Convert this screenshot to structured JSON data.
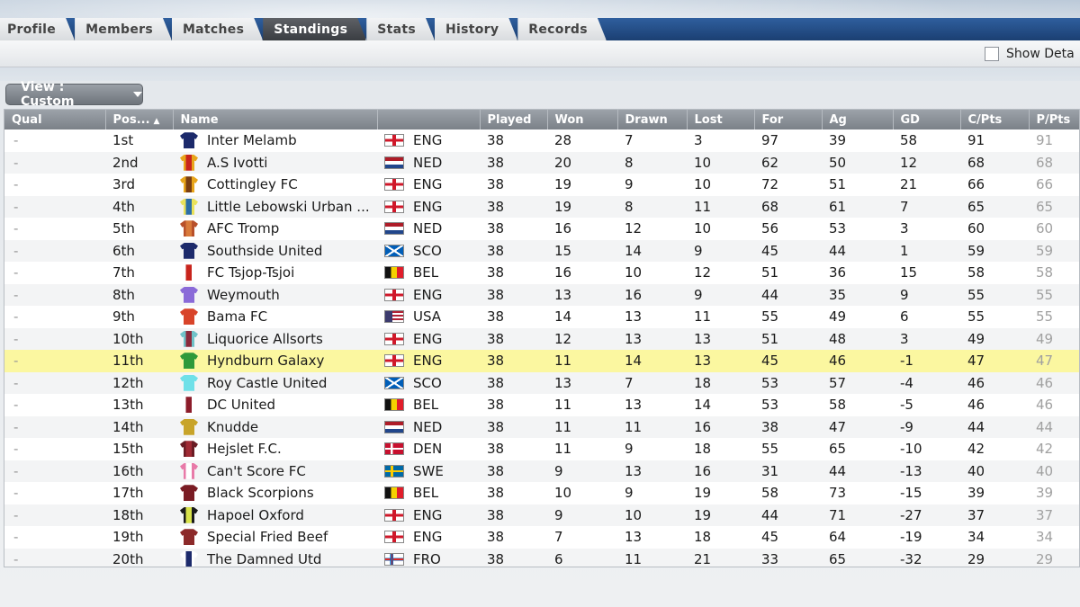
{
  "tabs": [
    {
      "label": "Profile",
      "active": false
    },
    {
      "label": "Members",
      "active": false
    },
    {
      "label": "Matches",
      "active": false
    },
    {
      "label": "Standings",
      "active": true
    },
    {
      "label": "Stats",
      "active": false
    },
    {
      "label": "History",
      "active": false
    },
    {
      "label": "Records",
      "active": false
    }
  ],
  "toolbar": {
    "show_detail_label": "Show Deta"
  },
  "view_button": {
    "label": "View : Custom"
  },
  "columns": [
    "Qual",
    "Pos...",
    "Name",
    "",
    "Played",
    "Won",
    "Drawn",
    "Lost",
    "For",
    "Ag",
    "GD",
    "C/Pts",
    "P/Pts"
  ],
  "sort_column": "Pos...",
  "rows": [
    {
      "qual": "-",
      "pos": "1st",
      "name": "Inter Melamb",
      "nation": "ENG",
      "played": "38",
      "won": "28",
      "drawn": "7",
      "lost": "3",
      "for": "97",
      "ag": "39",
      "gd": "58",
      "cpts": "91",
      "ppts": "91",
      "kit": [
        "#1c2a6b",
        "#1c2a6b"
      ],
      "flag": "eng"
    },
    {
      "qual": "-",
      "pos": "2nd",
      "name": "A.S Ivotti",
      "nation": "NED",
      "played": "38",
      "won": "20",
      "drawn": "8",
      "lost": "10",
      "for": "62",
      "ag": "50",
      "gd": "12",
      "cpts": "68",
      "ppts": "68",
      "kit": [
        "#e8a51a",
        "#c8241c"
      ],
      "flag": "ned"
    },
    {
      "qual": "-",
      "pos": "3rd",
      "name": "Cottingley FC",
      "nation": "ENG",
      "played": "38",
      "won": "19",
      "drawn": "9",
      "lost": "10",
      "for": "72",
      "ag": "51",
      "gd": "21",
      "cpts": "66",
      "ppts": "66",
      "kit": [
        "#e8a51a",
        "#7a3e12"
      ],
      "flag": "eng"
    },
    {
      "qual": "-",
      "pos": "4th",
      "name": "Little Lebowski Urban ...",
      "nation": "ENG",
      "played": "38",
      "won": "19",
      "drawn": "8",
      "lost": "11",
      "for": "68",
      "ag": "61",
      "gd": "7",
      "cpts": "65",
      "ppts": "65",
      "kit": [
        "#e9e25a",
        "#2b6ea8"
      ],
      "flag": "eng"
    },
    {
      "qual": "-",
      "pos": "5th",
      "name": "AFC Tromp",
      "nation": "NED",
      "played": "38",
      "won": "16",
      "drawn": "12",
      "lost": "10",
      "for": "56",
      "ag": "53",
      "gd": "3",
      "cpts": "60",
      "ppts": "60",
      "kit": [
        "#b8502a",
        "#d97a3a"
      ],
      "flag": "ned"
    },
    {
      "qual": "-",
      "pos": "6th",
      "name": "Southside United",
      "nation": "SCO",
      "played": "38",
      "won": "15",
      "drawn": "14",
      "lost": "9",
      "for": "45",
      "ag": "44",
      "gd": "1",
      "cpts": "59",
      "ppts": "59",
      "kit": [
        "#1c2a6b",
        "#1c2a6b"
      ],
      "flag": "sco"
    },
    {
      "qual": "-",
      "pos": "7th",
      "name": "FC Tsjop-Tsjoi",
      "nation": "BEL",
      "played": "38",
      "won": "16",
      "drawn": "10",
      "lost": "12",
      "for": "51",
      "ag": "36",
      "gd": "15",
      "cpts": "58",
      "ppts": "58",
      "kit": [
        "#ffffff",
        "#c8241c"
      ],
      "flag": "bel"
    },
    {
      "qual": "-",
      "pos": "8th",
      "name": "Weymouth",
      "nation": "ENG",
      "played": "38",
      "won": "13",
      "drawn": "16",
      "lost": "9",
      "for": "44",
      "ag": "35",
      "gd": "9",
      "cpts": "55",
      "ppts": "55",
      "kit": [
        "#8a6ad8",
        "#8a6ad8"
      ],
      "flag": "eng"
    },
    {
      "qual": "-",
      "pos": "9th",
      "name": "Bama FC",
      "nation": "USA",
      "played": "38",
      "won": "14",
      "drawn": "13",
      "lost": "11",
      "for": "55",
      "ag": "49",
      "gd": "6",
      "cpts": "55",
      "ppts": "55",
      "kit": [
        "#d8442a",
        "#d8442a"
      ],
      "flag": "usa"
    },
    {
      "qual": "-",
      "pos": "10th",
      "name": "Liquorice Allsorts",
      "nation": "ENG",
      "played": "38",
      "won": "12",
      "drawn": "13",
      "lost": "13",
      "for": "51",
      "ag": "48",
      "gd": "3",
      "cpts": "49",
      "ppts": "49",
      "kit": [
        "#6fc2c8",
        "#8c2a3c"
      ],
      "flag": "eng"
    },
    {
      "qual": "-",
      "pos": "11th",
      "name": "Hyndburn Galaxy",
      "nation": "ENG",
      "played": "38",
      "won": "11",
      "drawn": "14",
      "lost": "13",
      "for": "45",
      "ag": "46",
      "gd": "-1",
      "cpts": "47",
      "ppts": "47",
      "kit": [
        "#2e9a3a",
        "#2e9a3a"
      ],
      "flag": "eng",
      "highlight": true
    },
    {
      "qual": "-",
      "pos": "12th",
      "name": "Roy Castle United",
      "nation": "SCO",
      "played": "38",
      "won": "13",
      "drawn": "7",
      "lost": "18",
      "for": "53",
      "ag": "57",
      "gd": "-4",
      "cpts": "46",
      "ppts": "46",
      "kit": [
        "#6fe0e8",
        "#6fe0e8"
      ],
      "flag": "sco"
    },
    {
      "qual": "-",
      "pos": "13th",
      "name": "DC United",
      "nation": "BEL",
      "played": "38",
      "won": "11",
      "drawn": "13",
      "lost": "14",
      "for": "53",
      "ag": "58",
      "gd": "-5",
      "cpts": "46",
      "ppts": "46",
      "kit": [
        "#ffffff",
        "#8c1c2a"
      ],
      "flag": "bel"
    },
    {
      "qual": "-",
      "pos": "14th",
      "name": "Knudde",
      "nation": "NED",
      "played": "38",
      "won": "11",
      "drawn": "11",
      "lost": "16",
      "for": "38",
      "ag": "47",
      "gd": "-9",
      "cpts": "44",
      "ppts": "44",
      "kit": [
        "#c8a42a",
        "#c8a42a"
      ],
      "flag": "ned"
    },
    {
      "qual": "-",
      "pos": "15th",
      "name": "Hejslet F.C.",
      "nation": "DEN",
      "played": "38",
      "won": "11",
      "drawn": "9",
      "lost": "18",
      "for": "55",
      "ag": "65",
      "gd": "-10",
      "cpts": "42",
      "ppts": "42",
      "kit": [
        "#6a1c24",
        "#a02a34"
      ],
      "flag": "den"
    },
    {
      "qual": "-",
      "pos": "16th",
      "name": "Can't Score FC",
      "nation": "SWE",
      "played": "38",
      "won": "9",
      "drawn": "13",
      "lost": "16",
      "for": "31",
      "ag": "44",
      "gd": "-13",
      "cpts": "40",
      "ppts": "40",
      "kit": [
        "#e87aa8",
        "#ffffff"
      ],
      "flag": "swe"
    },
    {
      "qual": "-",
      "pos": "17th",
      "name": "Black Scorpions",
      "nation": "BEL",
      "played": "38",
      "won": "10",
      "drawn": "9",
      "lost": "19",
      "for": "58",
      "ag": "73",
      "gd": "-15",
      "cpts": "39",
      "ppts": "39",
      "kit": [
        "#7a1c24",
        "#7a1c24"
      ],
      "flag": "bel"
    },
    {
      "qual": "-",
      "pos": "18th",
      "name": "Hapoel Oxford",
      "nation": "ENG",
      "played": "38",
      "won": "9",
      "drawn": "10",
      "lost": "19",
      "for": "44",
      "ag": "71",
      "gd": "-27",
      "cpts": "37",
      "ppts": "37",
      "kit": [
        "#1a1a1a",
        "#d8e24a"
      ],
      "flag": "eng"
    },
    {
      "qual": "-",
      "pos": "19th",
      "name": "Special Fried Beef",
      "nation": "ENG",
      "played": "38",
      "won": "7",
      "drawn": "13",
      "lost": "18",
      "for": "45",
      "ag": "64",
      "gd": "-19",
      "cpts": "34",
      "ppts": "34",
      "kit": [
        "#8c2a2a",
        "#8c2a2a"
      ],
      "flag": "eng"
    },
    {
      "qual": "-",
      "pos": "20th",
      "name": "The Damned Utd",
      "nation": "FRO",
      "played": "38",
      "won": "6",
      "drawn": "11",
      "lost": "21",
      "for": "33",
      "ag": "65",
      "gd": "-32",
      "cpts": "29",
      "ppts": "29",
      "kit": [
        "#ffffff",
        "#1c2a6b"
      ],
      "flag": "fro"
    }
  ]
}
